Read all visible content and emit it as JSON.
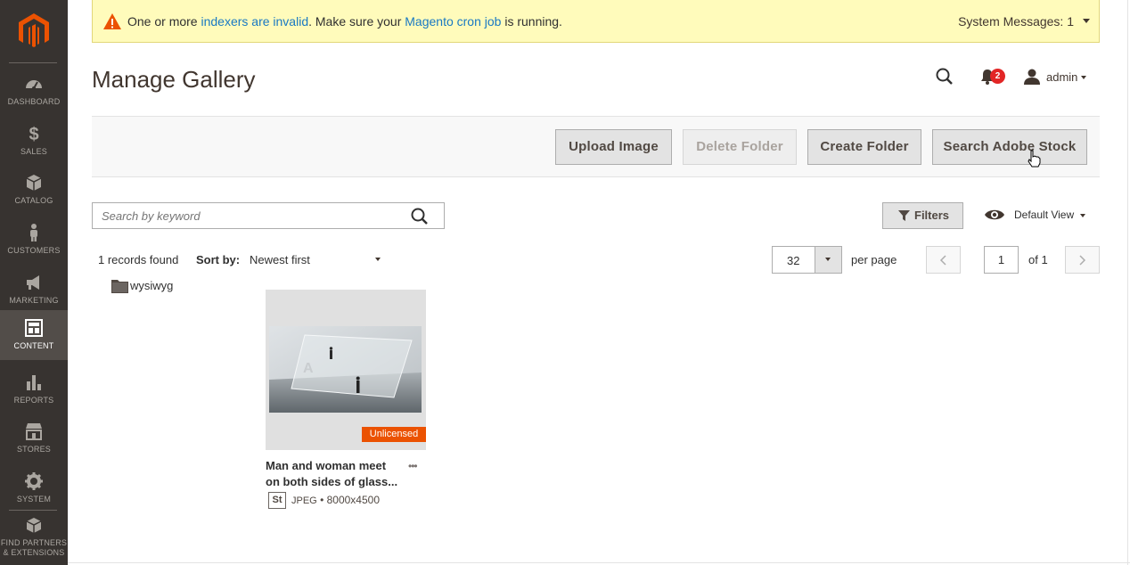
{
  "sidebar": {
    "items": [
      {
        "label": "DASHBOARD",
        "icon": "dashboard-icon"
      },
      {
        "label": "SALES",
        "icon": "dollar-icon"
      },
      {
        "label": "CATALOG",
        "icon": "cube-icon"
      },
      {
        "label": "CUSTOMERS",
        "icon": "person-icon"
      },
      {
        "label": "MARKETING",
        "icon": "megaphone-icon"
      },
      {
        "label": "CONTENT",
        "icon": "layout-icon",
        "active": true
      },
      {
        "label": "REPORTS",
        "icon": "bar-chart-icon"
      },
      {
        "label": "STORES",
        "icon": "storefront-icon"
      },
      {
        "label": "SYSTEM",
        "icon": "gear-icon"
      },
      {
        "label": "FIND PARTNERS & EXTENSIONS",
        "label_line1": "FIND PARTNERS",
        "label_line2": "& EXTENSIONS",
        "icon": "boxes-icon"
      }
    ],
    "brand_color": "#eb5202",
    "background": "#373330"
  },
  "system_message": {
    "prefix": "One or more ",
    "link1": "indexers are invalid",
    "middle": ". Make sure your ",
    "link2": "Magento cron job",
    "suffix": " is running.",
    "summary": "System Messages: 1"
  },
  "header": {
    "title": "Manage Gallery",
    "notification_count": "2",
    "user": "admin"
  },
  "actions": {
    "upload": "Upload Image",
    "delete_folder": "Delete Folder",
    "create_folder": "Create Folder",
    "search_stock": "Search Adobe Stock"
  },
  "toolbar": {
    "search_placeholder": "Search by keyword",
    "filters_label": "Filters",
    "view_label": "Default View",
    "records_found": "1 records found",
    "sort_label": "Sort by:",
    "sort_value": "Newest first",
    "per_page_value": "32",
    "per_page_label": "per page",
    "current_page": "1",
    "page_total": "of 1"
  },
  "folders": [
    {
      "name": "wysiwyg"
    }
  ],
  "gallery": {
    "items": [
      {
        "title_line1": "Man and woman meet",
        "title_line2": "on both sides of glass...",
        "badge": "Unlicensed",
        "source_badge": "St",
        "file_type": "JPEG",
        "separator": " • ",
        "dimensions": "8000x4500"
      }
    ]
  },
  "colors": {
    "link": "#1979c3",
    "warning_bg": "#fffbbb",
    "badge_unlicensed": "#eb5202",
    "notification_badge": "#e22626"
  }
}
